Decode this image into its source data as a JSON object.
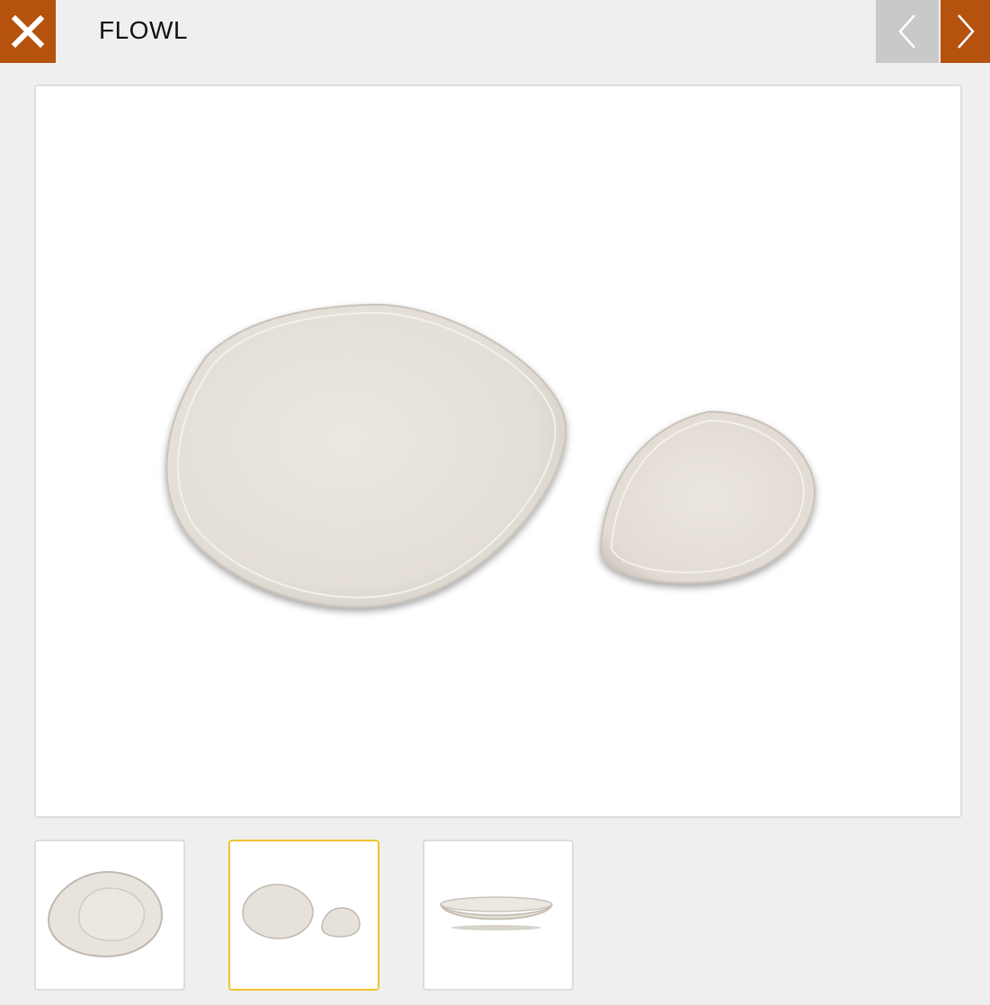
{
  "header": {
    "title": "FLOWL",
    "close_icon": "close-icon",
    "prev_icon": "chevron-left-icon",
    "next_icon": "chevron-right-icon"
  },
  "gallery": {
    "selected_index": 1,
    "thumbnails": [
      {
        "name": "thumbnail-plate-top-view"
      },
      {
        "name": "thumbnail-plate-pair"
      },
      {
        "name": "thumbnail-plate-side-view"
      }
    ]
  },
  "colors": {
    "accent": "#b5520e",
    "nav_disabled": "#c9c9c9",
    "selected_border": "#f2c233",
    "background": "#efefef"
  }
}
